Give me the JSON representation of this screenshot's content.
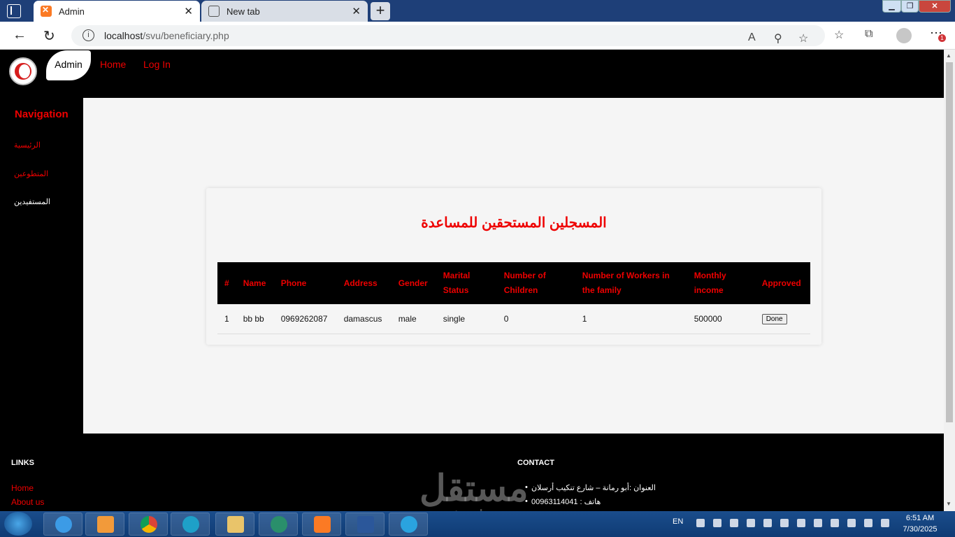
{
  "browser": {
    "tabs": [
      {
        "title": "Admin",
        "icon": "xampp-icon",
        "active": true
      },
      {
        "title": "New tab",
        "icon": "new-tab-icon",
        "active": false
      }
    ],
    "url": {
      "host": "localhost",
      "path": "/svu/beneficiary.php"
    }
  },
  "site": {
    "brand": "Admin",
    "nav": [
      "Home",
      "Log In"
    ]
  },
  "sidebar": {
    "title": "Navigation",
    "items": [
      {
        "label": "الرئيسية",
        "current": false
      },
      {
        "label": "المتطوعين",
        "current": false
      },
      {
        "label": "المستفيدين",
        "current": true
      }
    ]
  },
  "main": {
    "title": "المسجلين المستحقين للمساعدة",
    "table": {
      "headers": [
        "#",
        "Name",
        "Phone",
        "Address",
        "Gender",
        "Marital Status",
        "Number of Children",
        "Number of Workers in the family",
        "Monthly income",
        "Approved"
      ],
      "rows": [
        [
          "1",
          "bb bb",
          "0969262087",
          "damascus",
          "male",
          "single",
          "0",
          "1",
          "500000",
          "Done"
        ]
      ]
    }
  },
  "footer": {
    "links_title": "LINKS",
    "links": [
      "Home",
      "About us"
    ],
    "contact_title": "CONTACT",
    "contact": [
      "العنوان :أبو رمانة – شارع تنكيب أرسلان",
      "هاتف : 00963114041"
    ]
  },
  "watermark": {
    "arabic": "مستقل",
    "latin": "mostaql.com"
  },
  "taskbar": {
    "language": "EN",
    "time": "6:51 AM",
    "date": "7/30/2025"
  }
}
